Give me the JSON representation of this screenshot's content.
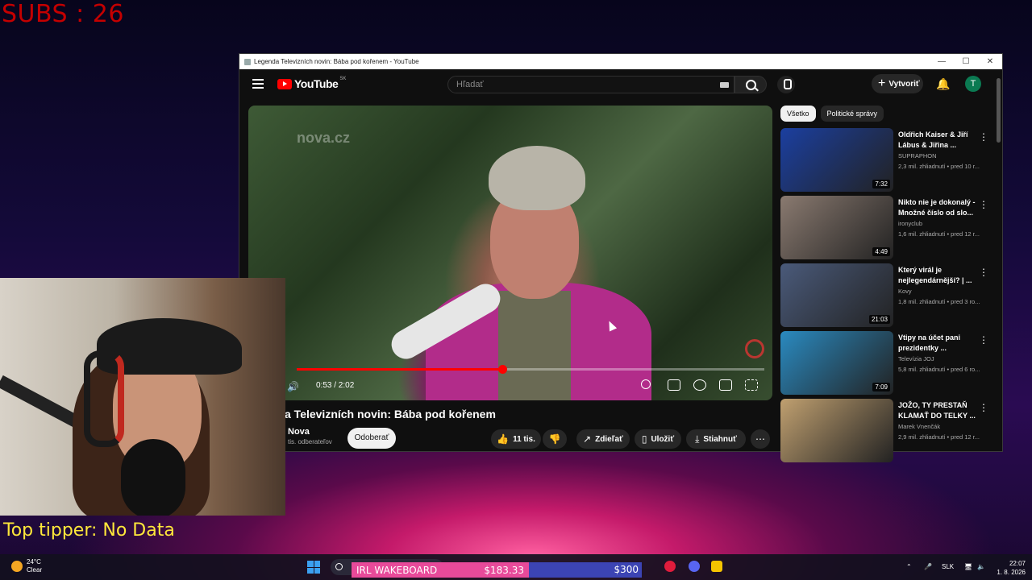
{
  "overlay": {
    "subs": "SUBS : 26",
    "tipper": "Top tipper: No Data"
  },
  "window": {
    "title": "Legenda Televizních novin: Bába pod kořenem - YouTube",
    "minimize": "—",
    "maximize": "☐",
    "close": "✕"
  },
  "youtube": {
    "logo_text": "YouTube",
    "region": "SK",
    "search_placeholder": "Hľadať",
    "create_label": "Vytvoriť",
    "avatar_letter": "T"
  },
  "video": {
    "watermark": "nova.cz",
    "time": "0:53 / 2:02",
    "progress_fraction": 0.44,
    "title": "a Televizních novin: Bába pod kořenem",
    "channel": "Nova",
    "subscribers": "tis. odberateľov",
    "subscribe_label": "Odoberať",
    "likes": "11 tis.",
    "share_label": "Zdieľať",
    "save_label": "Uložiť",
    "download_label": "Stiahnuť"
  },
  "chips": [
    "Všetko",
    "Politické správy"
  ],
  "recommendations": [
    {
      "title": "Oldřich Kaiser & Jiří Lábus & Jiřina ...",
      "channel": "SUPRAPHON",
      "meta": "2,3 mil. zhliadnutí • pred 10 r...",
      "duration": "7:32",
      "color": "#1b3fa0"
    },
    {
      "title": "Nikto nie je dokonalý - Množné číslo od slo...",
      "channel": "ironyclub",
      "meta": "1,6 mil. zhliadnutí • pred 12 r...",
      "duration": "4:49",
      "color": "#8a7a70"
    },
    {
      "title": "Který virál je nejlegendárnější? | ...",
      "channel": "Kovy",
      "meta": "1,8 mil. zhliadnutí • pred 3 ro...",
      "duration": "21:03",
      "color": "#4a5a7a"
    },
    {
      "title": "Vtipy na účet pani prezidentky ...",
      "channel": "Televízia JOJ",
      "meta": "5,8 mil. zhliadnutí • pred 6 ro...",
      "duration": "7:09",
      "color": "#2a8ac0"
    },
    {
      "title": "JOŽO, TY PRESTAŇ KLAMAŤ DO TELKY ...",
      "channel": "Marek Vnenčák",
      "meta": "2,9 mil. zhliadnutí • pred 12 r...",
      "duration": "",
      "color": "#c0a070"
    }
  ],
  "taskbar": {
    "temp": "24°C",
    "weather": "Clear",
    "goal_name": "IRL WAKEBOARD",
    "goal_current": "$183.33",
    "goal_target": "$300",
    "lang": "SLK",
    "time": "22:07",
    "date": "1. 8. 2026"
  }
}
